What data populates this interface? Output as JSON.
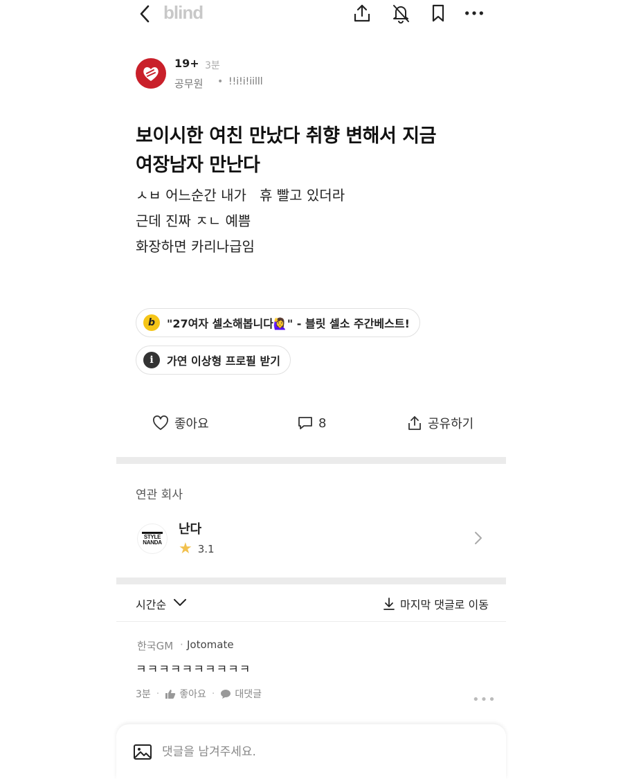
{
  "header": {
    "brand": "blind"
  },
  "author": {
    "tag": "19+",
    "time": "3분",
    "company": "공무원",
    "separator": "•",
    "nickname": "!!i!i!iilll"
  },
  "post": {
    "title_line1": "보이시한 여친 만났다 취향 변해서 지금",
    "title_line2": "여장남자 만난다",
    "body": [
      "ㅅㅂ 어느순간 내가   휴 빨고 있더라",
      "근데 진짜 ㅈㄴ 예쁨",
      "화장하면 카리나급임"
    ]
  },
  "chips": {
    "promo_icon": "b",
    "promo_label": "\"27여자 셀소해봅니다🙋‍♀️\" - 블릿 셀소 주간베스트!",
    "profile_icon": "i",
    "profile_label": "가연 이상형 프로필 받기"
  },
  "actions": {
    "like_label": "좋아요",
    "comment_count": "8",
    "share_label": "공유하기"
  },
  "related": {
    "section_title": "연관 회사",
    "logo_line1": "STYLE",
    "logo_line2": "NANDA",
    "company_name": "난다",
    "rating": "3.1"
  },
  "comments_bar": {
    "sort_label": "시간순",
    "jump_label": "마지막 댓글로 이동"
  },
  "comment": {
    "company": "한국GM",
    "separator": "·",
    "nickname": "Jotomate",
    "text": "ㅋㅋㅋㅋㅋㅋㅋㅋㅋㅋ",
    "time": "3분",
    "like_label": "좋아요",
    "reply_label": "대댓글",
    "meta_separator": "·",
    "more": "•••"
  },
  "input": {
    "placeholder": "댓글을 남겨주세요."
  },
  "colors": {
    "brand_gray": "#c8c8c8",
    "avatar_red": "#c9202a",
    "chip_yellow": "#f5c518",
    "star": "#f2c14e"
  },
  "icons": [
    "back-icon",
    "share-upload-icon",
    "bell-off-icon",
    "bookmark-icon",
    "more-icon",
    "heart-icon",
    "comment-icon",
    "share-icon",
    "chevron-right-icon",
    "chevron-down-icon",
    "download-arrow-icon",
    "thumbs-up-icon",
    "speech-bubble-icon",
    "image-icon",
    "star-icon"
  ]
}
